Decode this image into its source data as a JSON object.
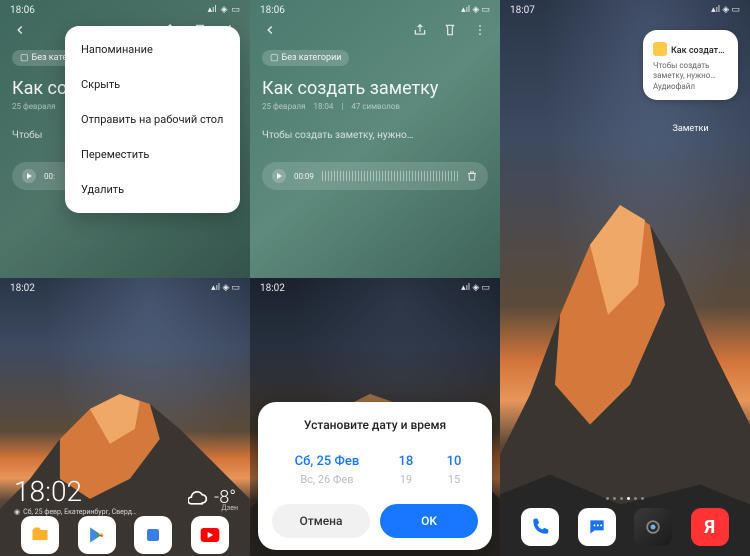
{
  "panel1": {
    "top": {
      "time": "18:06",
      "chip": "Без категории",
      "title": "Как соз",
      "date": "25 февраля",
      "body": "Чтобы",
      "audio_time": "00:"
    },
    "menu": [
      "Напоминание",
      "Скрыть",
      "Отправить на рабочий стол",
      "Переместить",
      "Удалить"
    ],
    "bottom": {
      "time": "18:02",
      "clock": "18:02",
      "date_line": "Сб, 25 февр, Екатеринбург, Сверд…",
      "temp": "-8°",
      "feed": "Дзен"
    }
  },
  "panel2": {
    "top": {
      "time": "18:06",
      "chip": "Без категории",
      "title": "Как создать заметку",
      "date": "25 февраля",
      "edit_time": "18:04",
      "chars": "47 символов",
      "body": "Чтобы создать заметку, нужно…",
      "audio_time": "00:09"
    },
    "bottom": {
      "time": "18:02",
      "dialog_title": "Установите дату и время",
      "sel_date": "Сб, 25 Фев",
      "sel_hour": "18",
      "sel_min": "10",
      "alt_date": "Вс, 26 Фев",
      "alt_hour": "19",
      "alt_min": "15",
      "cancel": "Отмена",
      "ok": "OK"
    }
  },
  "panel3": {
    "time": "18:07",
    "widget": {
      "title": "Как создат…",
      "body": "Чтобы создать заметку, нужно…\nАудиофайл",
      "label": "Заметки"
    },
    "dock_y": "Я"
  }
}
